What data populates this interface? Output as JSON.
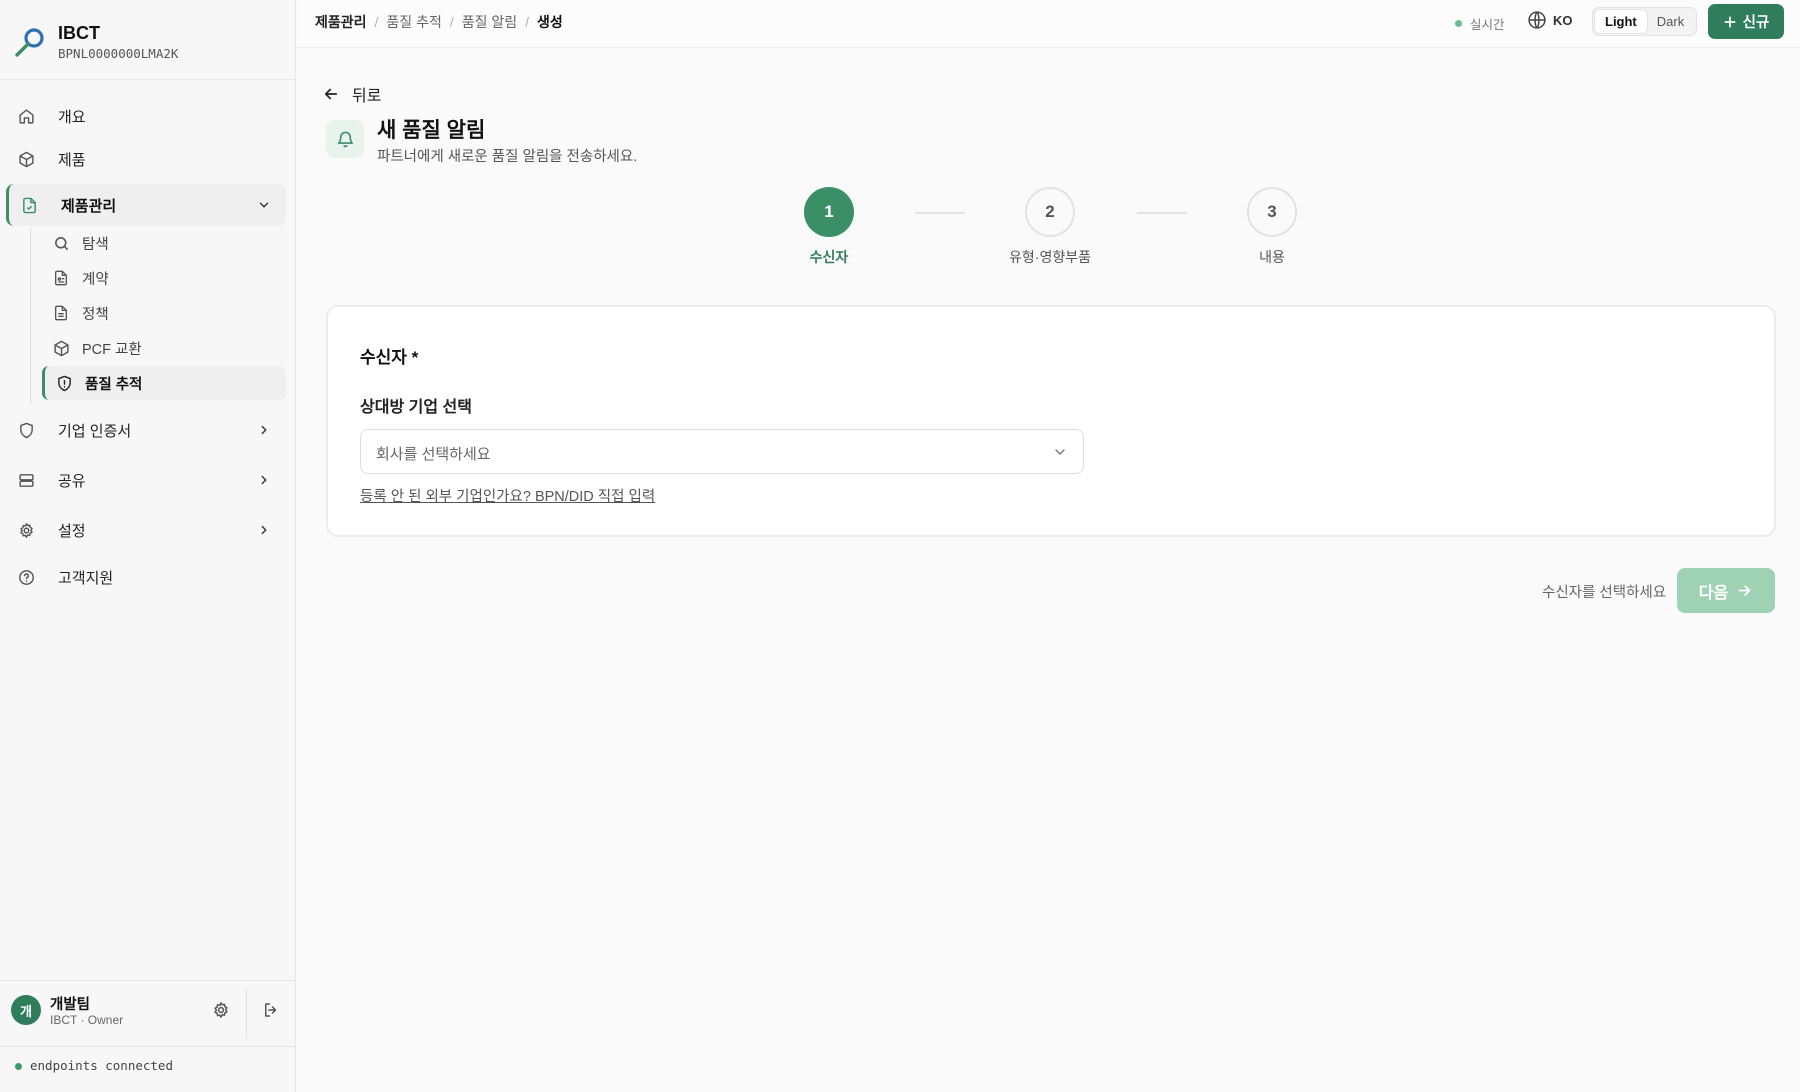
{
  "app": {
    "org_name": "IBCT",
    "org_id": "BPNL0000000LMA2K"
  },
  "sidebar": {
    "items": [
      {
        "label": "개요",
        "icon": "home-icon"
      },
      {
        "label": "제품",
        "icon": "package-icon"
      },
      {
        "label": "제품관리",
        "icon": "file-check-icon",
        "expanded": true
      },
      {
        "label": "기업 인증서",
        "icon": "shield-icon"
      },
      {
        "label": "공유",
        "icon": "server-icon"
      },
      {
        "label": "설정",
        "icon": "gear-icon"
      },
      {
        "label": "고객지원",
        "icon": "help-circle-icon"
      }
    ],
    "sub_items": [
      {
        "label": "탐색",
        "icon": "search-icon"
      },
      {
        "label": "계약",
        "icon": "contract-icon"
      },
      {
        "label": "정책",
        "icon": "document-icon"
      },
      {
        "label": "PCF 교환",
        "icon": "package-icon"
      },
      {
        "label": "품질 추적",
        "icon": "shield-alert-icon",
        "active": true
      }
    ]
  },
  "user": {
    "avatar": "개",
    "name": "개발팀",
    "role": "IBCT · Owner"
  },
  "footer": {
    "status": "endpoints connected"
  },
  "topbar": {
    "breadcrumbs": [
      "제품관리",
      "품질 추적",
      "품질 알림",
      "생성"
    ],
    "live_label": "실시간",
    "lang": "KO",
    "theme_light": "Light",
    "theme_dark": "Dark",
    "theme_selected": "Light",
    "new_button": "신규"
  },
  "page": {
    "back_label": "뒤로",
    "title": "새 품질 알림",
    "subtitle": "파트너에게 새로운 품질 알림을 전송하세요."
  },
  "stepper": {
    "current": 1,
    "steps": [
      {
        "num": "1",
        "label": "수신자"
      },
      {
        "num": "2",
        "label": "유형·영향부품"
      },
      {
        "num": "3",
        "label": "내용"
      }
    ]
  },
  "form": {
    "section_title": "수신자 *",
    "field_label": "상대방 기업 선택",
    "select_placeholder": "회사를 선택하세요",
    "external_link": "등록 안 된 외부 기업인가요? BPN/DID 직접 입력"
  },
  "actions": {
    "hint": "수신자를 선택하세요",
    "next_label": "다음",
    "next_disabled": true
  },
  "colors": {
    "accent": "#2f7d5b",
    "step_active": "#3a8f67",
    "next_disabled": "#9fd1b5",
    "live_dot": "#66c08f"
  }
}
